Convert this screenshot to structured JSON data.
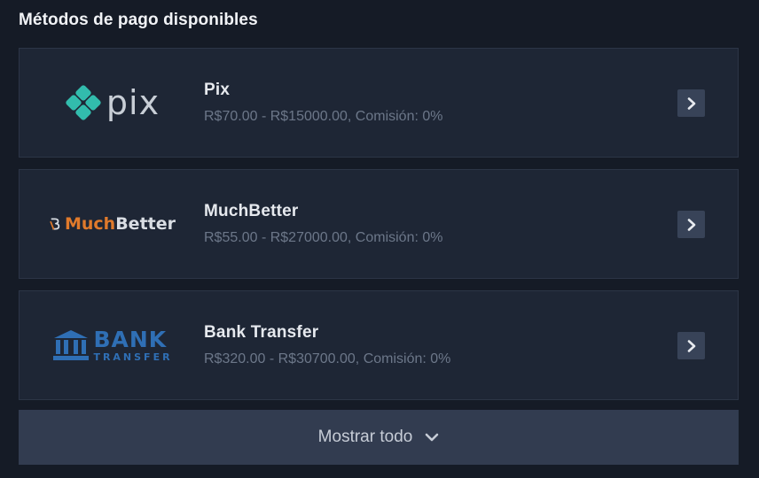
{
  "section": {
    "title": "Métodos de pago disponibles"
  },
  "methods": [
    {
      "name": "Pix",
      "range": "R$70.00 - R$15000.00, Comisión: 0%",
      "logo": {
        "text": "pix",
        "icon": "pix-diamond-icon",
        "color": "#32bcad"
      }
    },
    {
      "name": "MuchBetter",
      "range": "R$55.00 - R$27000.00, Comisión: 0%",
      "logo": {
        "text_part1": "Much",
        "text_part2": "Better",
        "icon": "muchbetter-b-icon",
        "color": "#e07a2b"
      }
    },
    {
      "name": "Bank Transfer",
      "range": "R$320.00 - R$30700.00, Comisión: 0%",
      "logo": {
        "text_big": "BANK",
        "text_small": "TRANSFER",
        "icon": "bank-building-icon",
        "color": "#2f6fb5"
      }
    }
  ],
  "show_all": {
    "label": "Mostrar todo",
    "icon": "chevron-down-icon"
  },
  "colors": {
    "background": "#151b26",
    "card": "#1e2635",
    "button": "#323c50",
    "arrow_button": "#384358"
  }
}
